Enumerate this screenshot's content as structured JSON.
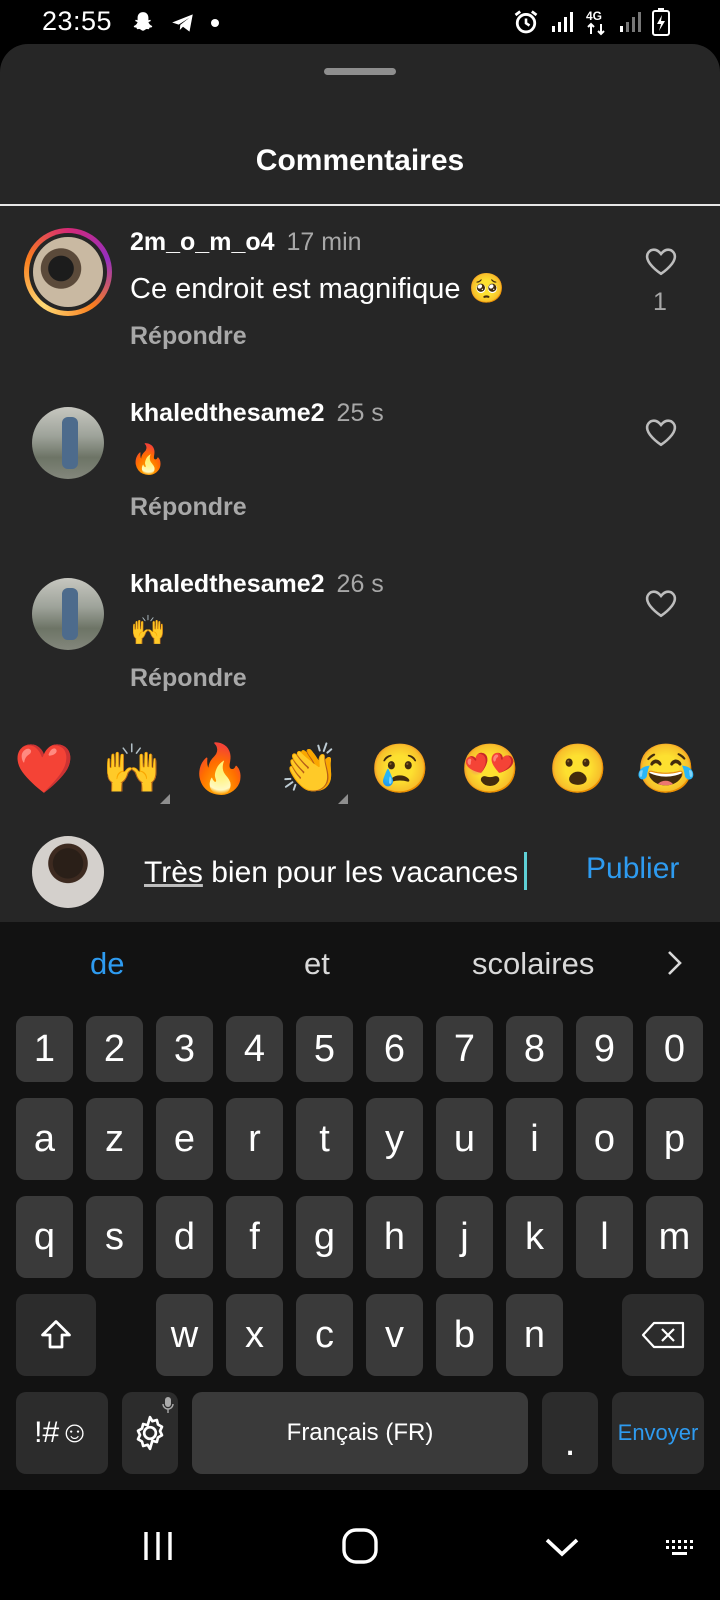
{
  "status_bar": {
    "time": "23:55",
    "network": "4G"
  },
  "sheet": {
    "title": "Commentaires"
  },
  "comments": [
    {
      "user": "2m_o_m_o4",
      "time": "17 min",
      "text": "Ce endroit est magnifique 🥺",
      "reply": "Répondre",
      "likes": "1"
    },
    {
      "user": "khaledthesame2",
      "time": "25 s",
      "text": "🔥",
      "reply": "Répondre"
    },
    {
      "user": "khaledthesame2",
      "time": "26 s",
      "text": "🙌",
      "reply": "Répondre"
    }
  ],
  "reactions": [
    "❤️",
    "🙌",
    "🔥",
    "👏",
    "😢",
    "😍",
    "😮",
    "😂"
  ],
  "composer": {
    "first_word": "Très",
    "rest": " bien pour les vacances",
    "publish": "Publier"
  },
  "keyboard": {
    "suggestions": [
      "de",
      "et",
      "scolaires"
    ],
    "rows": {
      "numbers": [
        "1",
        "2",
        "3",
        "4",
        "5",
        "6",
        "7",
        "8",
        "9",
        "0"
      ],
      "row1": [
        "a",
        "z",
        "e",
        "r",
        "t",
        "y",
        "u",
        "i",
        "o",
        "p"
      ],
      "row2": [
        "q",
        "s",
        "d",
        "f",
        "g",
        "h",
        "j",
        "k",
        "l",
        "m"
      ],
      "row3": [
        "w",
        "x",
        "c",
        "v",
        "b",
        "n"
      ]
    },
    "symbols": "!#☺",
    "space": "Français (FR)",
    "period": ".",
    "enter": "Envoyer"
  },
  "colors": {
    "accent": "#2e9bf0",
    "sheet_bg": "#262626",
    "key_bg": "#3a3a3a"
  }
}
